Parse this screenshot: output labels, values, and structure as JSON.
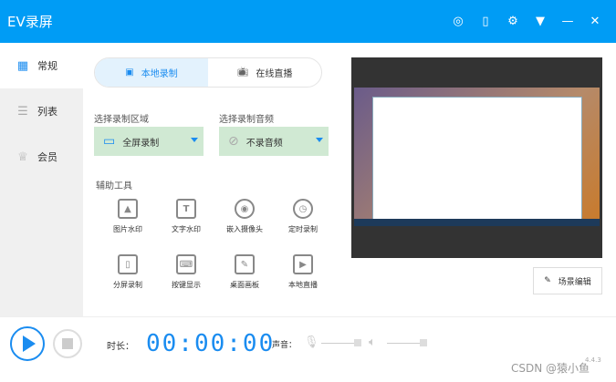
{
  "app": {
    "title": "EV录屏"
  },
  "titlebar": {
    "icons": [
      "user-icon",
      "phone-icon",
      "gear-icon",
      "dropdown-icon",
      "minimize-icon",
      "close-icon"
    ]
  },
  "sidebar": {
    "items": [
      {
        "label": "常规",
        "icon": "grid-icon"
      },
      {
        "label": "列表",
        "icon": "list-icon"
      },
      {
        "label": "会员",
        "icon": "crown-icon"
      }
    ]
  },
  "mode_tabs": [
    {
      "label": "本地录制"
    },
    {
      "label": "在线直播"
    }
  ],
  "area": {
    "label": "选择录制区域",
    "value": "全屏录制"
  },
  "audio": {
    "label": "选择录制音频",
    "value": "不录音频"
  },
  "tools": {
    "label": "辅助工具",
    "items": [
      {
        "label": "图片水印",
        "glyph": "▲"
      },
      {
        "label": "文字水印",
        "glyph": "T"
      },
      {
        "label": "嵌入摄像头",
        "glyph": "◉"
      },
      {
        "label": "定时录制",
        "glyph": "◷"
      },
      {
        "label": "分屏录制",
        "glyph": "▯"
      },
      {
        "label": "按键显示",
        "glyph": "⌨"
      },
      {
        "label": "桌面画板",
        "glyph": "✎"
      },
      {
        "label": "本地直播",
        "glyph": "▶"
      }
    ]
  },
  "preview": {
    "scene_edit": "场景编辑"
  },
  "bottom": {
    "duration_label": "时长：",
    "timer": "00:00:00",
    "volume_label": "声音："
  },
  "watermark": "CSDN @猿小鱼",
  "version": "4.4.3",
  "colors": {
    "accent": "#009cf5",
    "select_bg": "#d0e9d3"
  }
}
